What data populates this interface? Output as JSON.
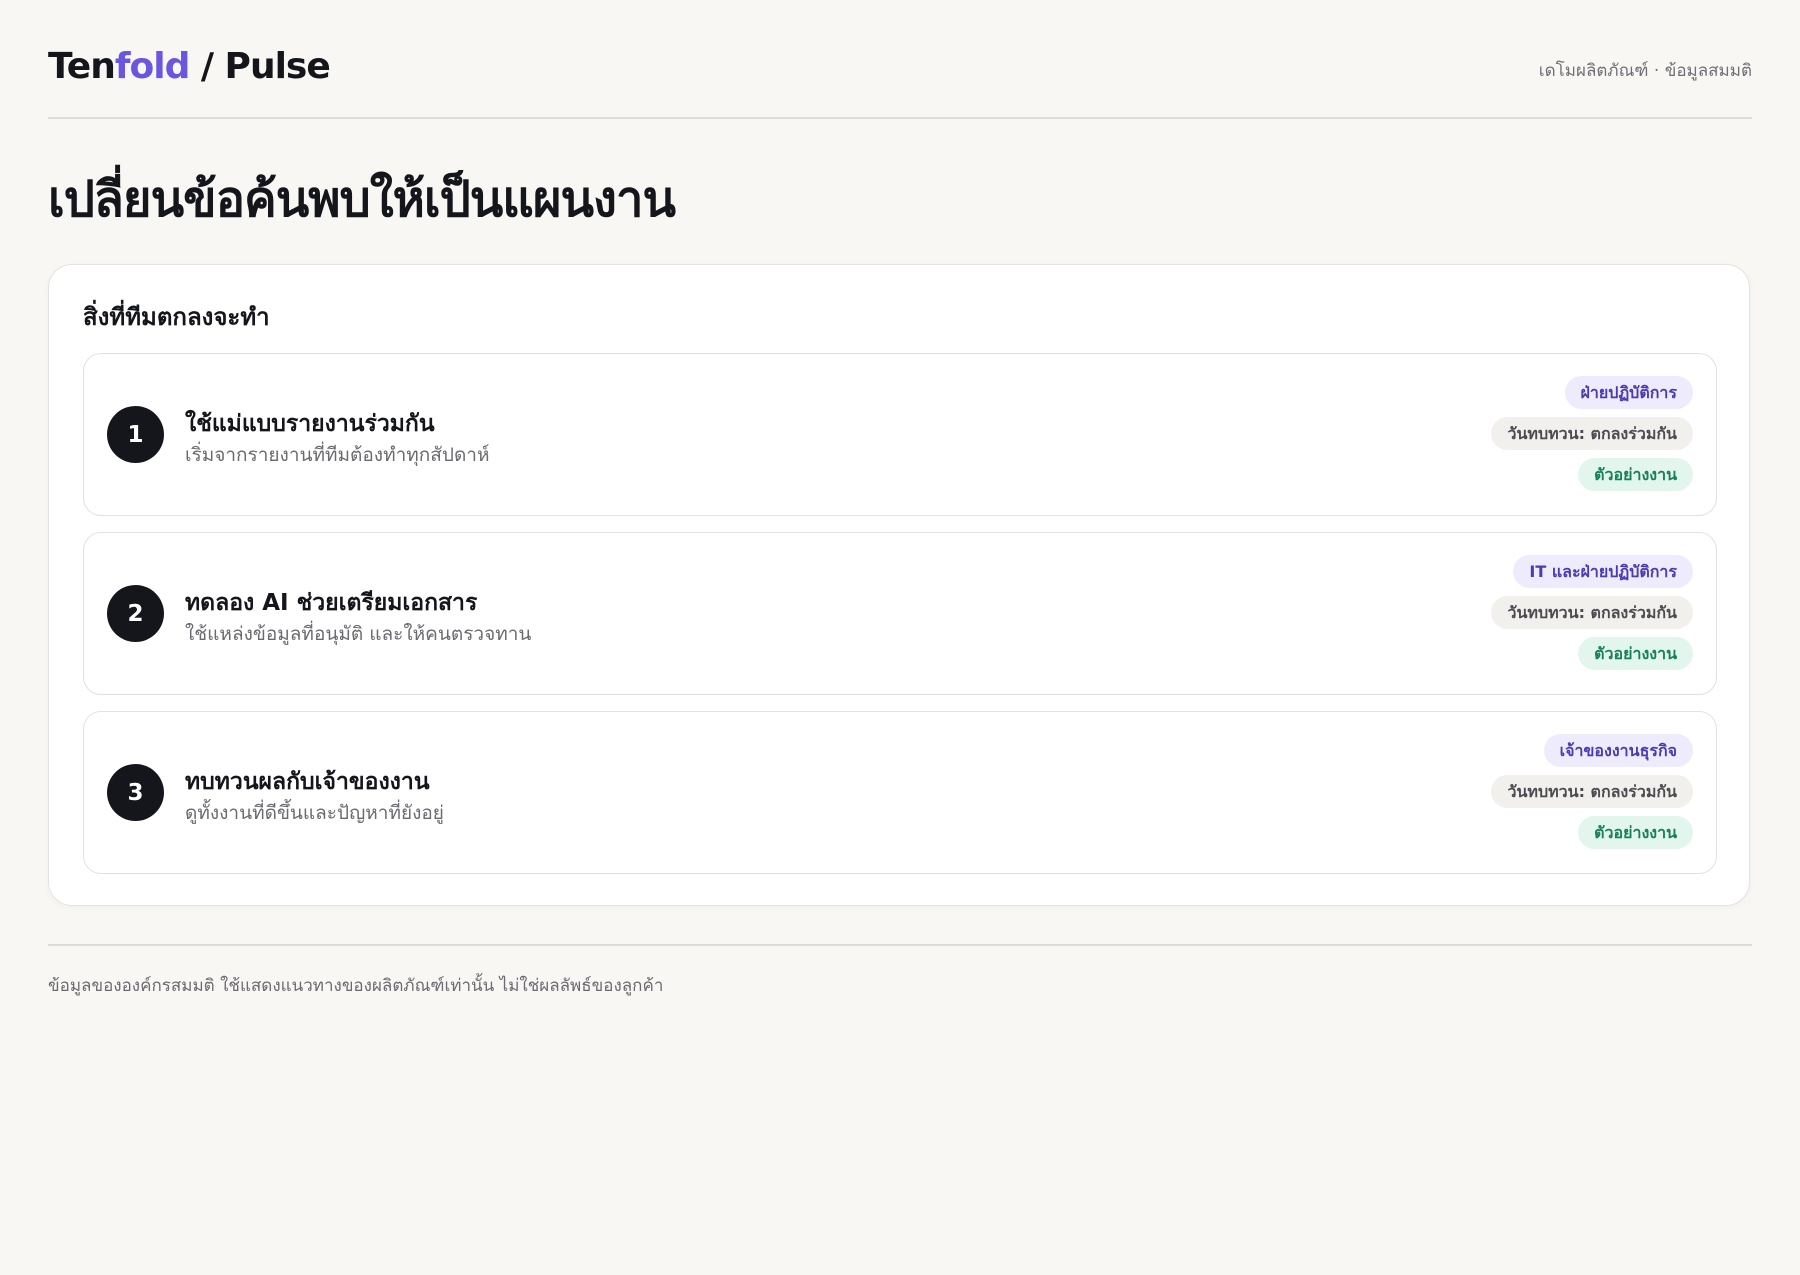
{
  "header": {
    "brand_prefix": "Ten",
    "brand_accent": "fold",
    "brand_suffix": " / Pulse",
    "meta": "เดโมผลิตภัณฑ์ · ข้อมูลสมมติ"
  },
  "page": {
    "title": "เปลี่ยนข้อค้นพบให้เป็นแผนงาน"
  },
  "card": {
    "title": "สิ่งที่ทีมตกลงจะทำ",
    "items": [
      {
        "number": "1",
        "title": "ใช้แม่แบบรายงานร่วมกัน",
        "subtitle": "เริ่มจากรายงานที่ทีมต้องทำทุกสัปดาห์",
        "owner": "ฝ่ายปฏิบัติการ",
        "status": "วันทบทวน: ตกลงร่วมกัน",
        "example": "ตัวอย่างงาน"
      },
      {
        "number": "2",
        "title": "ทดลอง AI ช่วยเตรียมเอกสาร",
        "subtitle": "ใช้แหล่งข้อมูลที่อนุมัติ และให้คนตรวจทาน",
        "owner": "IT และฝ่ายปฏิบัติการ",
        "status": "วันทบทวน: ตกลงร่วมกัน",
        "example": "ตัวอย่างงาน"
      },
      {
        "number": "3",
        "title": "ทบทวนผลกับเจ้าของงาน",
        "subtitle": "ดูทั้งงานที่ดีขึ้นและปัญหาที่ยังอยู่",
        "owner": "เจ้าของงานธุรกิจ",
        "status": "วันทบทวน: ตกลงร่วมกัน",
        "example": "ตัวอย่างงาน"
      }
    ]
  },
  "footer": {
    "note": "ข้อมูลขององค์กรสมมติ ใช้แสดงแนวทางของผลิตภัณฑ์เท่านั้น ไม่ใช่ผลลัพธ์ของลูกค้า"
  },
  "colors": {
    "accent": "#6a56e0",
    "background": "#f8f7f4",
    "owner_tag_bg": "#eeebfd",
    "status_tag_bg": "#f1f0ec",
    "example_tag_bg": "#e3f6ee"
  }
}
